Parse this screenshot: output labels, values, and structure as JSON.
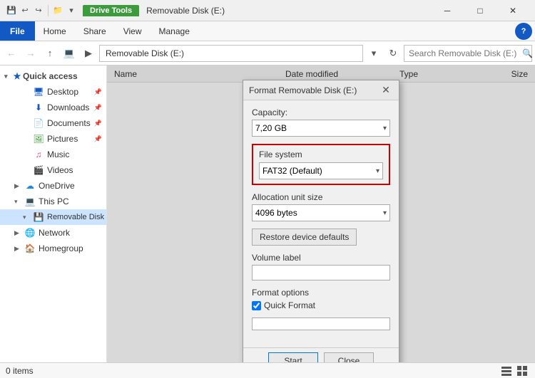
{
  "titleBar": {
    "driveTools": "Drive Tools",
    "title": "Removable Disk (E:)",
    "minimize": "─",
    "maximize": "□",
    "close": "✕"
  },
  "ribbon": {
    "tabs": [
      "File",
      "Home",
      "Share",
      "View",
      "Manage"
    ],
    "activeTab": "Home",
    "help": "?"
  },
  "addressBar": {
    "back": "←",
    "forward": "→",
    "up": "↑",
    "computerIcon": "💻",
    "path": "Removable Disk (E:)",
    "refresh": "↻",
    "searchPlaceholder": "Search Removable Disk (E:)",
    "searchIcon": "🔍"
  },
  "sidebar": {
    "quickAccess": "Quick access",
    "items": [
      {
        "label": "Desktop",
        "indent": 2,
        "pin": true
      },
      {
        "label": "Downloads",
        "indent": 2,
        "pin": true
      },
      {
        "label": "Documents",
        "indent": 2,
        "pin": true
      },
      {
        "label": "Pictures",
        "indent": 2,
        "pin": true
      },
      {
        "label": "Music",
        "indent": 2
      },
      {
        "label": "Videos",
        "indent": 2
      },
      {
        "label": "OneDrive",
        "indent": 1
      },
      {
        "label": "This PC",
        "indent": 1
      },
      {
        "label": "Removable Disk (E:)",
        "indent": 2,
        "selected": true
      },
      {
        "label": "Network",
        "indent": 1
      },
      {
        "label": "Homegroup",
        "indent": 1
      }
    ]
  },
  "fileList": {
    "columns": [
      "Name",
      "Date modified",
      "Type",
      "Size"
    ]
  },
  "modal": {
    "title": "Format Removable Disk (E:)",
    "capacity": {
      "label": "Capacity:",
      "value": "7,20 GB"
    },
    "fileSystem": {
      "label": "File system",
      "value": "FAT32 (Default)"
    },
    "allocationUnit": {
      "label": "Allocation unit size",
      "value": "4096 bytes"
    },
    "restoreBtn": "Restore device defaults",
    "volumeLabel": {
      "label": "Volume label",
      "value": ""
    },
    "formatOptions": {
      "label": "Format options",
      "quickFormat": "Quick Format",
      "quickFormatChecked": true
    },
    "startBtn": "Start",
    "closeBtn": "Close"
  },
  "statusBar": {
    "items": "0 items",
    "listView": "≡",
    "tileView": "⊞"
  }
}
